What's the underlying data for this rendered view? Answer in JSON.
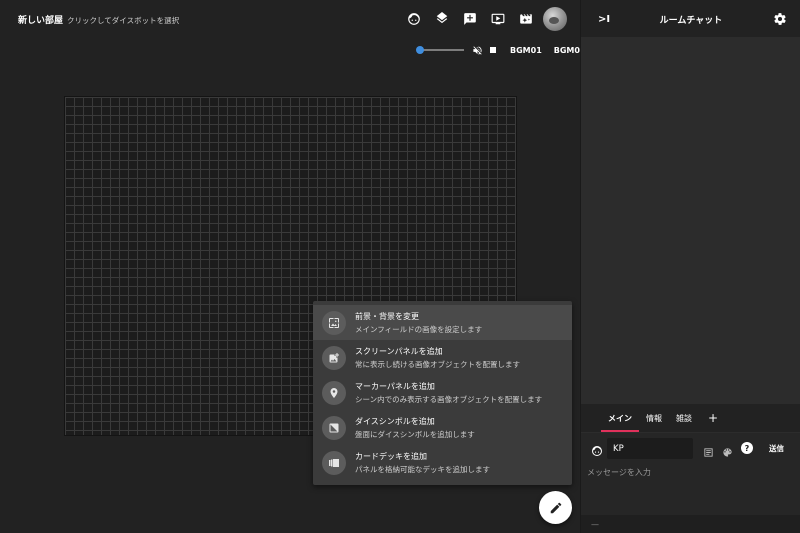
{
  "header": {
    "room_name": "新しい部屋",
    "hint": "クリックしてダイスボットを選択"
  },
  "top_icons": [
    "face-icon",
    "layers-icon",
    "add-comment-icon",
    "slideshow-icon",
    "movie-filter-icon"
  ],
  "bgm": {
    "volume_level": 0.0,
    "bgm01_label": "BGM01",
    "bgm02_label": "BGM02"
  },
  "speed_menu": {
    "items": [
      {
        "title": "前景・背景を変更",
        "desc": "メインフィールドの画像を設定します",
        "icon": "wallpaper-icon"
      },
      {
        "title": "スクリーンパネルを追加",
        "desc": "常に表示し続ける画像オブジェクトを配置します",
        "icon": "add-photo-icon"
      },
      {
        "title": "マーカーパネルを追加",
        "desc": "シーン内でのみ表示する画像オブジェクトを配置します",
        "icon": "place-icon"
      },
      {
        "title": "ダイスシンボルを追加",
        "desc": "盤面にダイスシンボルを追加します",
        "icon": "dice-icon"
      },
      {
        "title": "カードデッキを追加",
        "desc": "パネルを格納可能なデッキを追加します",
        "icon": "deck-icon"
      }
    ]
  },
  "chat": {
    "collapse_label": ">I",
    "title": "ルームチャット",
    "tabs": [
      "メイン",
      "情報",
      "雑談"
    ],
    "add_tab_label": "+",
    "character_name": "KP",
    "help_label": "?",
    "send_label": "送信",
    "message_placeholder": "メッセージを入力",
    "footer_text": "—"
  },
  "colors": {
    "accent": "#e0315b",
    "slider": "#3f8edf",
    "background": "#222222",
    "panel": "#2c2c2c"
  }
}
